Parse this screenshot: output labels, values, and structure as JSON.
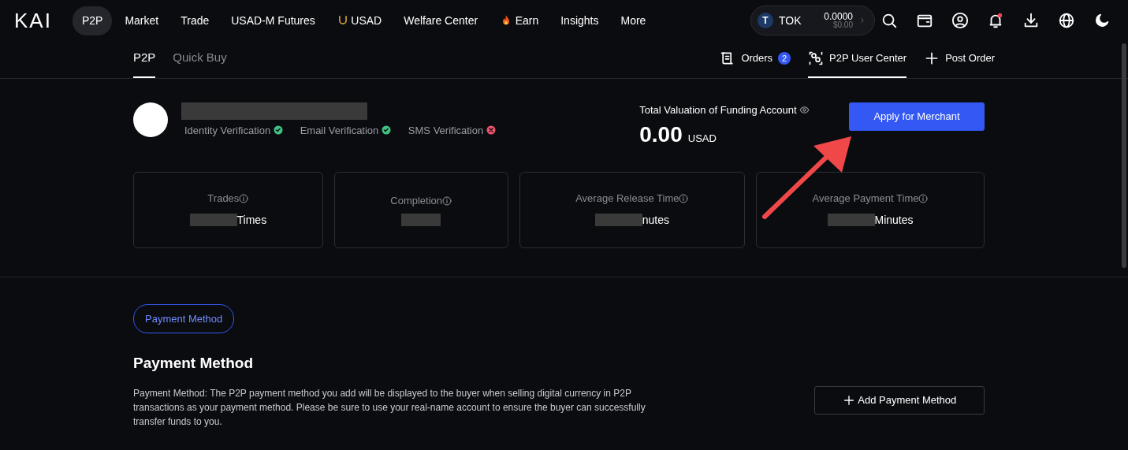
{
  "nav": {
    "logo": "KAI",
    "items": [
      {
        "label": "P2P",
        "selected": true
      },
      {
        "label": "Market",
        "selected": false
      },
      {
        "label": "Trade",
        "selected": false
      },
      {
        "label": "USAD-M Futures",
        "selected": false
      },
      {
        "label": "USAD",
        "selected": false
      },
      {
        "label": "Welfare Center",
        "selected": false
      },
      {
        "label": "Earn",
        "selected": false
      },
      {
        "label": "Insights",
        "selected": false
      },
      {
        "label": "More",
        "selected": false
      }
    ],
    "wallet": {
      "symbol": "T",
      "coin": "TOK",
      "amount": "0.0000",
      "usd": "$0.00"
    },
    "notifications_unread": true
  },
  "subnav": {
    "tabs": [
      {
        "label": "P2P",
        "selected": true
      },
      {
        "label": "Quick Buy",
        "selected": false
      }
    ],
    "actions": [
      {
        "label": "Orders",
        "badge": "2",
        "selected": false
      },
      {
        "label": "P2P User Center",
        "selected": true
      },
      {
        "label": "Post Order",
        "selected": false
      }
    ]
  },
  "profile": {
    "verifications": [
      {
        "label": "Identity Verification",
        "verified": true
      },
      {
        "label": "Email Verification",
        "verified": true
      },
      {
        "label": "SMS Verification",
        "verified": false
      }
    ],
    "valuation": {
      "label": "Total Valuation of Funding Account",
      "amount": "0.00",
      "currency": "USAD"
    },
    "apply_button": "Apply for Merchant"
  },
  "stats": [
    {
      "label": "Trades",
      "value": "Times"
    },
    {
      "label": "Completion"
    },
    {
      "label": "Average Release Time",
      "value": "nutes"
    },
    {
      "label": "Average Payment Time",
      "value": "Minutes"
    }
  ],
  "section_tab": {
    "label": "Payment Method",
    "selected": true
  },
  "payment": {
    "title": "Payment Method",
    "description": "Payment Method: The P2P payment method you add will be displayed to the buyer when selling digital currency in P2P transactions as your payment method. Please be sure to use your real-name account to ensure the buyer can successfully transfer funds to you.",
    "button": "Add Payment Method"
  }
}
